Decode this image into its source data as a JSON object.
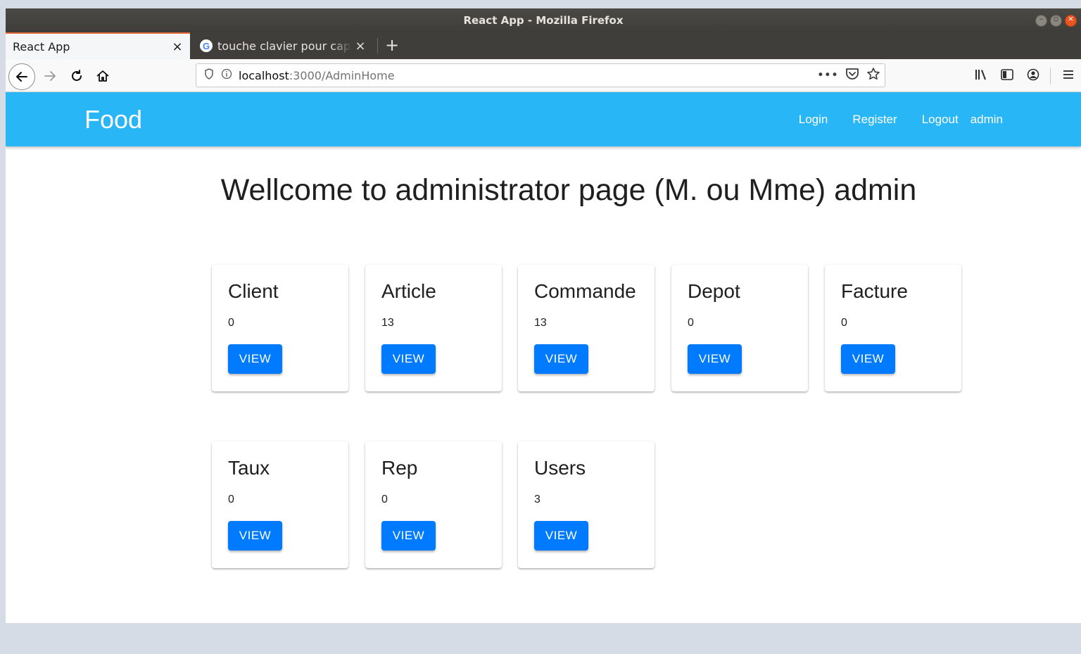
{
  "window": {
    "title": "React App - Mozilla Firefox"
  },
  "tabs": [
    {
      "label": "React App"
    },
    {
      "label": "touche clavier pour capture"
    }
  ],
  "url": {
    "host": "localhost",
    "path": ":3000/AdminHome"
  },
  "app": {
    "brand": "Food",
    "nav": {
      "login": "Login",
      "register": "Register",
      "logout": "Logout",
      "user": "admin"
    },
    "welcome": "Wellcome to administrator page (M. ou Mme) admin"
  },
  "cards": [
    {
      "title": "Client",
      "count": "0",
      "button": "VIEW"
    },
    {
      "title": "Article",
      "count": "13",
      "button": "VIEW"
    },
    {
      "title": "Commande",
      "count": "13",
      "button": "VIEW"
    },
    {
      "title": "Depot",
      "count": "0",
      "button": "VIEW"
    },
    {
      "title": "Facture",
      "count": "0",
      "button": "VIEW"
    },
    {
      "title": "Taux",
      "count": "0",
      "button": "VIEW"
    },
    {
      "title": "Rep",
      "count": "0",
      "button": "VIEW"
    },
    {
      "title": "Users",
      "count": "3",
      "button": "VIEW"
    }
  ],
  "colors": {
    "appbar": "#29b6f6",
    "button": "#007bff",
    "tab_accent": "#e66b3b"
  }
}
